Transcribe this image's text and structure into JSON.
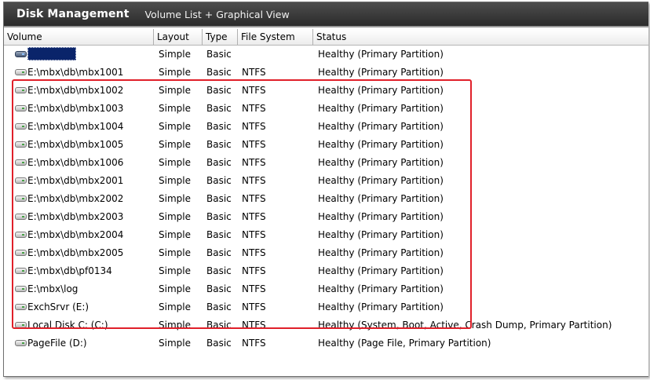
{
  "titlebar": {
    "title": "Disk Management",
    "subtitle": "Volume List + Graphical View"
  },
  "columns": [
    "Volume",
    "Layout",
    "Type",
    "File System",
    "Status"
  ],
  "rows": [
    {
      "volume": "",
      "layout": "Simple",
      "type": "Basic",
      "fs": "",
      "status": "Healthy (Primary Partition)",
      "icon": "disk-dark-icon",
      "selected": true
    },
    {
      "volume": "E:\\mbx\\db\\mbx1001",
      "layout": "Simple",
      "type": "Basic",
      "fs": "NTFS",
      "status": "Healthy (Primary Partition)",
      "icon": "disk-icon"
    },
    {
      "volume": "E:\\mbx\\db\\mbx1002",
      "layout": "Simple",
      "type": "Basic",
      "fs": "NTFS",
      "status": "Healthy (Primary Partition)",
      "icon": "disk-icon"
    },
    {
      "volume": "E:\\mbx\\db\\mbx1003",
      "layout": "Simple",
      "type": "Basic",
      "fs": "NTFS",
      "status": "Healthy (Primary Partition)",
      "icon": "disk-icon"
    },
    {
      "volume": "E:\\mbx\\db\\mbx1004",
      "layout": "Simple",
      "type": "Basic",
      "fs": "NTFS",
      "status": "Healthy (Primary Partition)",
      "icon": "disk-icon"
    },
    {
      "volume": "E:\\mbx\\db\\mbx1005",
      "layout": "Simple",
      "type": "Basic",
      "fs": "NTFS",
      "status": "Healthy (Primary Partition)",
      "icon": "disk-icon"
    },
    {
      "volume": "E:\\mbx\\db\\mbx1006",
      "layout": "Simple",
      "type": "Basic",
      "fs": "NTFS",
      "status": "Healthy (Primary Partition)",
      "icon": "disk-icon"
    },
    {
      "volume": "E:\\mbx\\db\\mbx2001",
      "layout": "Simple",
      "type": "Basic",
      "fs": "NTFS",
      "status": "Healthy (Primary Partition)",
      "icon": "disk-icon"
    },
    {
      "volume": "E:\\mbx\\db\\mbx2002",
      "layout": "Simple",
      "type": "Basic",
      "fs": "NTFS",
      "status": "Healthy (Primary Partition)",
      "icon": "disk-icon"
    },
    {
      "volume": "E:\\mbx\\db\\mbx2003",
      "layout": "Simple",
      "type": "Basic",
      "fs": "NTFS",
      "status": "Healthy (Primary Partition)",
      "icon": "disk-icon"
    },
    {
      "volume": "E:\\mbx\\db\\mbx2004",
      "layout": "Simple",
      "type": "Basic",
      "fs": "NTFS",
      "status": "Healthy (Primary Partition)",
      "icon": "disk-icon"
    },
    {
      "volume": "E:\\mbx\\db\\mbx2005",
      "layout": "Simple",
      "type": "Basic",
      "fs": "NTFS",
      "status": "Healthy (Primary Partition)",
      "icon": "disk-icon"
    },
    {
      "volume": "E:\\mbx\\db\\pf0134",
      "layout": "Simple",
      "type": "Basic",
      "fs": "NTFS",
      "status": "Healthy (Primary Partition)",
      "icon": "disk-icon"
    },
    {
      "volume": "E:\\mbx\\log",
      "layout": "Simple",
      "type": "Basic",
      "fs": "NTFS",
      "status": "Healthy (Primary Partition)",
      "icon": "disk-icon"
    },
    {
      "volume": "ExchSrvr (E:)",
      "layout": "Simple",
      "type": "Basic",
      "fs": "NTFS",
      "status": "Healthy (Primary Partition)",
      "icon": "disk-icon"
    },
    {
      "volume": "Local Disk C: (C:)",
      "layout": "Simple",
      "type": "Basic",
      "fs": "NTFS",
      "status": "Healthy (System, Boot, Active, Crash Dump, Primary Partition)",
      "icon": "disk-icon"
    },
    {
      "volume": "PageFile (D:)",
      "layout": "Simple",
      "type": "Basic",
      "fs": "NTFS",
      "status": "Healthy (Page File, Primary Partition)",
      "icon": "disk-icon"
    }
  ],
  "annotation": {
    "highlight_color": "#e0202a"
  }
}
